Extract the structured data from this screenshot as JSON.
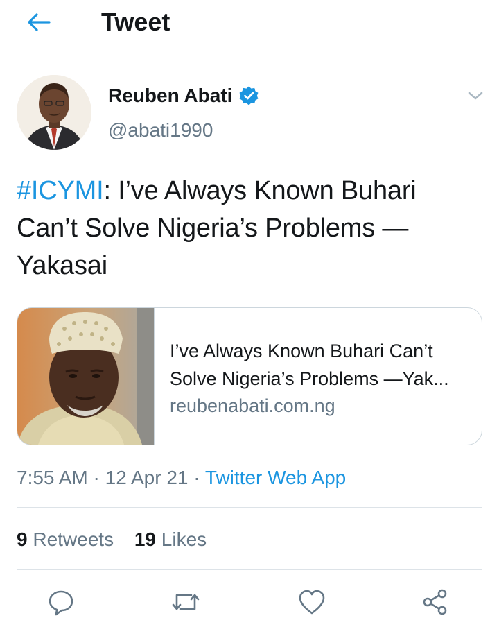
{
  "header": {
    "title": "Tweet",
    "back_icon": "arrow-left-icon"
  },
  "author": {
    "name": "Reuben Abati",
    "handle": "@abati1990",
    "verified": true
  },
  "tweet": {
    "hashtag": "#ICYMI",
    "text": ": I’ve Always Known Buhari Can’t Solve Nigeria’s Problems — Yakasai"
  },
  "card": {
    "title_line1": "I’ve Always Known Buhari Can’t",
    "title_line2": "Solve Nigeria’s Problems —Yak...",
    "domain": "reubenabati.com.ng"
  },
  "meta": {
    "time": "7:55 AM",
    "date": "12 Apr 21",
    "separator": "·",
    "source": "Twitter Web App"
  },
  "stats": {
    "retweets_count": "9",
    "retweets_label": "Retweets",
    "likes_count": "19",
    "likes_label": "Likes"
  },
  "colors": {
    "accent": "#1b95e0",
    "text": "#14171a",
    "secondary": "#657786",
    "border": "#dde3e8"
  },
  "actions": [
    "reply-icon",
    "retweet-icon",
    "like-icon",
    "share-icon"
  ]
}
